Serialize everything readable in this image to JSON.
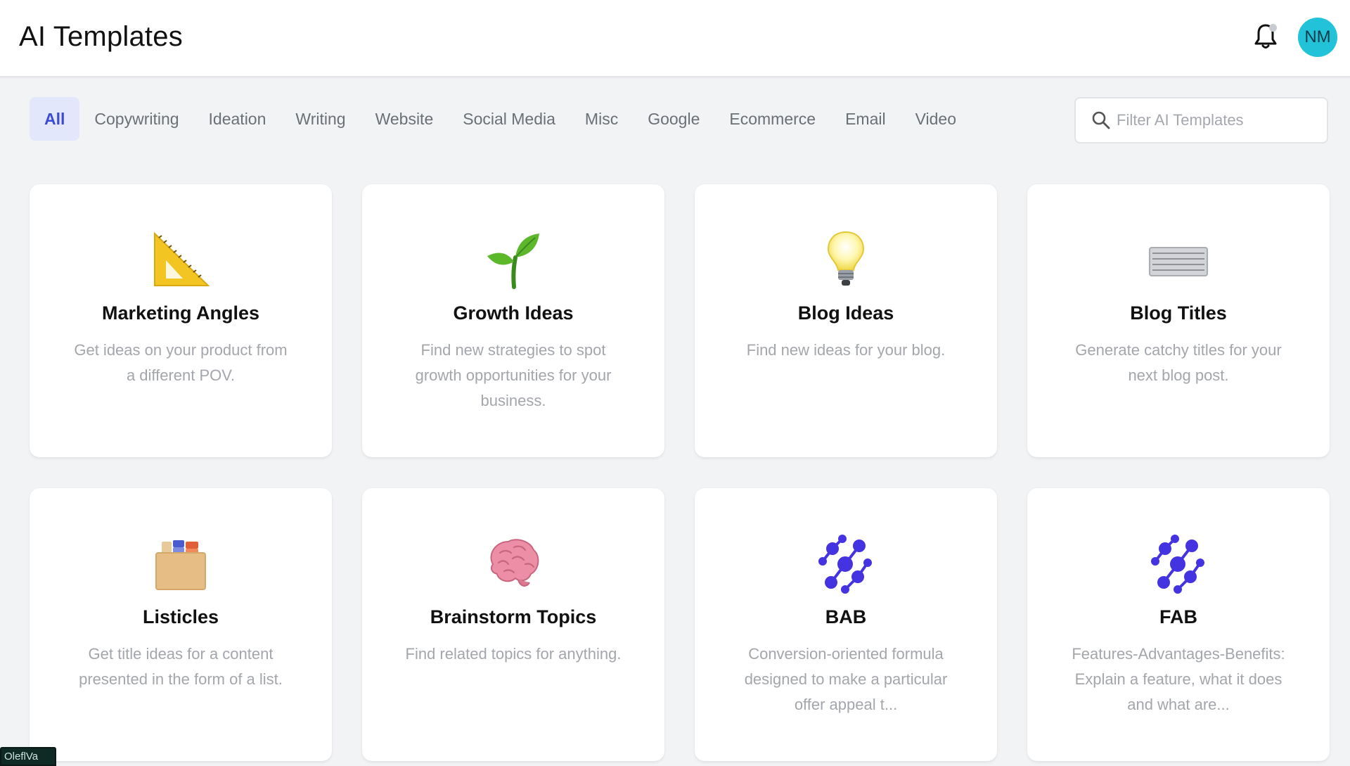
{
  "header": {
    "title": "AI Templates",
    "notifications_icon": "bell-icon",
    "avatar": {
      "initials": "NM",
      "color": "#22c3d8"
    }
  },
  "colors": {
    "accent": "#3b4bd8",
    "active_tab_bg": "#e3e7fb",
    "page_bg": "#f2f3f5",
    "card_bg": "#ffffff"
  },
  "tabs": [
    {
      "label": "All",
      "active": true
    },
    {
      "label": "Copywriting",
      "active": false
    },
    {
      "label": "Ideation",
      "active": false
    },
    {
      "label": "Writing",
      "active": false
    },
    {
      "label": "Website",
      "active": false
    },
    {
      "label": "Social Media",
      "active": false
    },
    {
      "label": "Misc",
      "active": false
    },
    {
      "label": "Google",
      "active": false
    },
    {
      "label": "Ecommerce",
      "active": false
    },
    {
      "label": "Email",
      "active": false
    },
    {
      "label": "Video",
      "active": false
    }
  ],
  "search": {
    "placeholder": "Filter AI Templates",
    "value": "",
    "icon": "search-icon"
  },
  "cards": [
    {
      "title": "Marketing Angles",
      "description": "Get ideas on your product from a different POV.",
      "icon": "triangular-ruler-icon"
    },
    {
      "title": "Growth Ideas",
      "description": "Find new strategies to spot growth opportunities for your business.",
      "icon": "seedling-icon"
    },
    {
      "title": "Blog Ideas",
      "description": "Find new ideas for your blog.",
      "icon": "light-bulb-icon"
    },
    {
      "title": "Blog Titles",
      "description": "Generate catchy titles for your next blog post.",
      "icon": "keyboard-icon"
    },
    {
      "title": "Listicles",
      "description": "Get title ideas for a content presented in the form of a list.",
      "icon": "card-file-box-icon"
    },
    {
      "title": "Brainstorm Topics",
      "description": "Find related topics for anything.",
      "icon": "brain-icon"
    },
    {
      "title": "BAB",
      "description": "Conversion-oriented formula designed to make a particular offer appeal t...",
      "icon": "molecule-pattern-icon"
    },
    {
      "title": "FAB",
      "description": "Features-Advantages-Benefits: Explain a feature, what it does and what are...",
      "icon": "molecule-pattern-icon"
    }
  ],
  "overlay_badge": {
    "text": "OleflVa"
  }
}
